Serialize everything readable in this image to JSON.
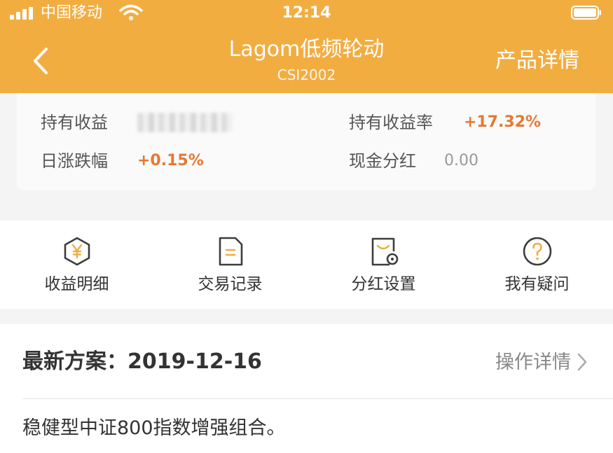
{
  "status_bar": {
    "carrier": "中国移动",
    "time": "12:14"
  },
  "nav": {
    "title": "Lagom低频轮动",
    "subtitle": "CSI2002",
    "right_action": "产品详情"
  },
  "summary": {
    "holding_profit_label": "持有收益",
    "holding_profit_rate_label": "持有收益率",
    "holding_profit_rate_value": "+17.32%",
    "daily_change_label": "日涨跌幅",
    "daily_change_value": "+0.15%",
    "cash_dividend_label": "现金分红",
    "cash_dividend_value": "0.00"
  },
  "shortcuts": [
    {
      "label": "收益明细",
      "icon": "yen-hexagon-icon"
    },
    {
      "label": "交易记录",
      "icon": "document-icon"
    },
    {
      "label": "分红设置",
      "icon": "dividend-settings-icon"
    },
    {
      "label": "我有疑问",
      "icon": "question-circle-icon"
    }
  ],
  "plan": {
    "heading": "最新方案：",
    "date": "2019-12-16",
    "link_label": "操作详情",
    "description": "稳健型中证800指数增强组合。"
  },
  "colors": {
    "header": "#f2ad41",
    "positive": "#e67832",
    "icon": "#3d3d3d",
    "icon_accent": "#f2ad41"
  }
}
